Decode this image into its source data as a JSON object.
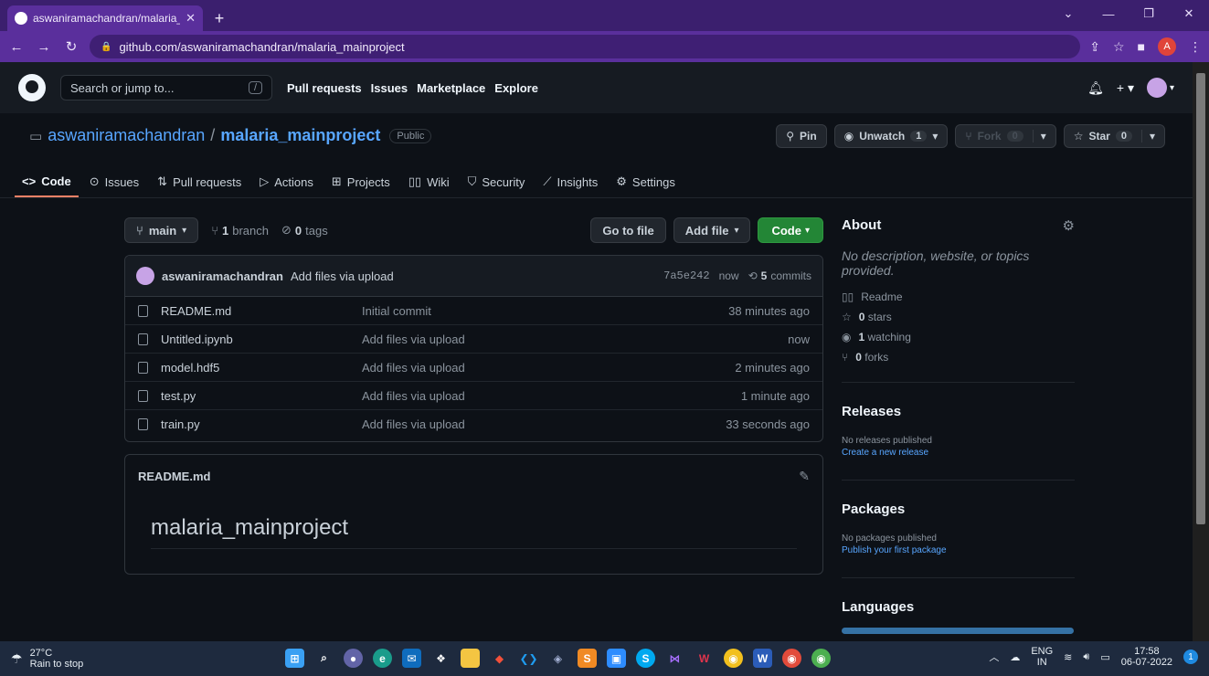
{
  "browser": {
    "tab_title": "aswaniramachandran/malaria_ma",
    "url": "github.com/aswaniramachandran/malaria_mainproject",
    "profile_initial": "A"
  },
  "header": {
    "search_placeholder": "Search or jump to...",
    "search_shortcut": "/",
    "nav": [
      "Pull requests",
      "Issues",
      "Marketplace",
      "Explore"
    ]
  },
  "repo": {
    "owner": "aswaniramachandran",
    "separator": "/",
    "name": "malaria_mainproject",
    "visibility": "Public",
    "pin_label": "Pin",
    "unwatch_label": "Unwatch",
    "unwatch_count": "1",
    "fork_label": "Fork",
    "fork_count": "0",
    "star_label": "Star",
    "star_count": "0",
    "tabs": [
      "Code",
      "Issues",
      "Pull requests",
      "Actions",
      "Projects",
      "Wiki",
      "Security",
      "Insights",
      "Settings"
    ]
  },
  "branch_bar": {
    "branch": "main",
    "branch_count": "1",
    "branch_word": "branch",
    "tag_count": "0",
    "tag_word": "tags",
    "go_to_file": "Go to file",
    "add_file": "Add file",
    "code": "Code"
  },
  "commit": {
    "author": "aswaniramachandran",
    "message": "Add files via upload",
    "sha": "7a5e242",
    "time": "now",
    "count": "5",
    "count_word": "commits"
  },
  "files": [
    {
      "name": "README.md",
      "message": "Initial commit",
      "time": "38 minutes ago"
    },
    {
      "name": "Untitled.ipynb",
      "message": "Add files via upload",
      "time": "now"
    },
    {
      "name": "model.hdf5",
      "message": "Add files via upload",
      "time": "2 minutes ago"
    },
    {
      "name": "test.py",
      "message": "Add files via upload",
      "time": "1 minute ago"
    },
    {
      "name": "train.py",
      "message": "Add files via upload",
      "time": "33 seconds ago"
    }
  ],
  "readme": {
    "file": "README.md",
    "heading": "malaria_mainproject"
  },
  "about": {
    "title": "About",
    "description": "No description, website, or topics provided.",
    "readme": "Readme",
    "stars_count": "0",
    "stars_word": "stars",
    "watching_count": "1",
    "watching_word": "watching",
    "forks_count": "0",
    "forks_word": "forks"
  },
  "releases": {
    "title": "Releases",
    "none": "No releases published",
    "link": "Create a new release"
  },
  "packages": {
    "title": "Packages",
    "none": "No packages published",
    "link": "Publish your first package"
  },
  "languages": {
    "title": "Languages"
  },
  "taskbar": {
    "temp": "27°C",
    "weather": "Rain to stop",
    "lang": "ENG",
    "region": "IN",
    "time": "17:58",
    "date": "06-07-2022",
    "notifications": "1"
  },
  "colors": {
    "accent_blue": "#58a6ff",
    "green_button": "#238636",
    "tab_underline": "#f78166",
    "browser_purple": "#5a2f9c",
    "language_bar": "#3572a5"
  }
}
